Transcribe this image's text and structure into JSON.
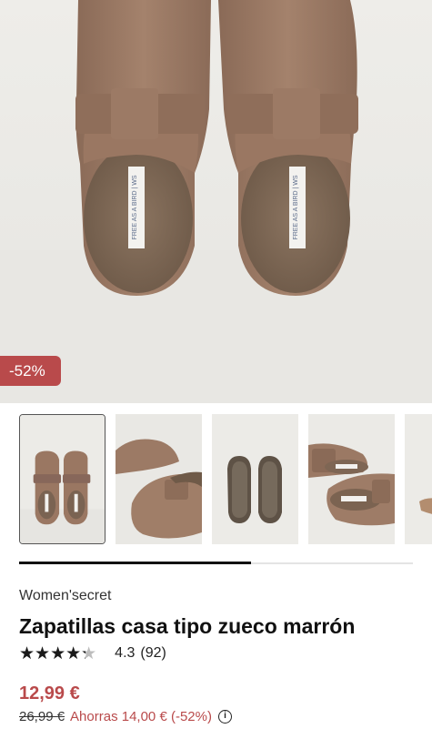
{
  "product": {
    "badge": "-52%",
    "brand": "Women'secret",
    "title": "Zapatillas casa tipo zueco marrón",
    "rating": {
      "stars": "★★★★★",
      "value": "4.3",
      "value_fraction": 0.86,
      "count": "(92)"
    },
    "price": "12,99 €",
    "old_price": "26,99 €",
    "savings": "Ahorras 14,00 € (-52%)",
    "insole_label": "FREE AS A BIRD | WS"
  },
  "gallery": {
    "thumbnails": [
      {
        "name": "front-view",
        "selected": true
      },
      {
        "name": "side-view",
        "selected": false
      },
      {
        "name": "sole-view",
        "selected": false
      },
      {
        "name": "top-view",
        "selected": false
      },
      {
        "name": "partial-view",
        "selected": false
      }
    ],
    "scroll_progress": 0.59
  },
  "colors": {
    "accent": "#b94a4b",
    "suede": "#9a7762",
    "background": "#ecebe7"
  },
  "icons": {
    "info": "info-icon"
  }
}
